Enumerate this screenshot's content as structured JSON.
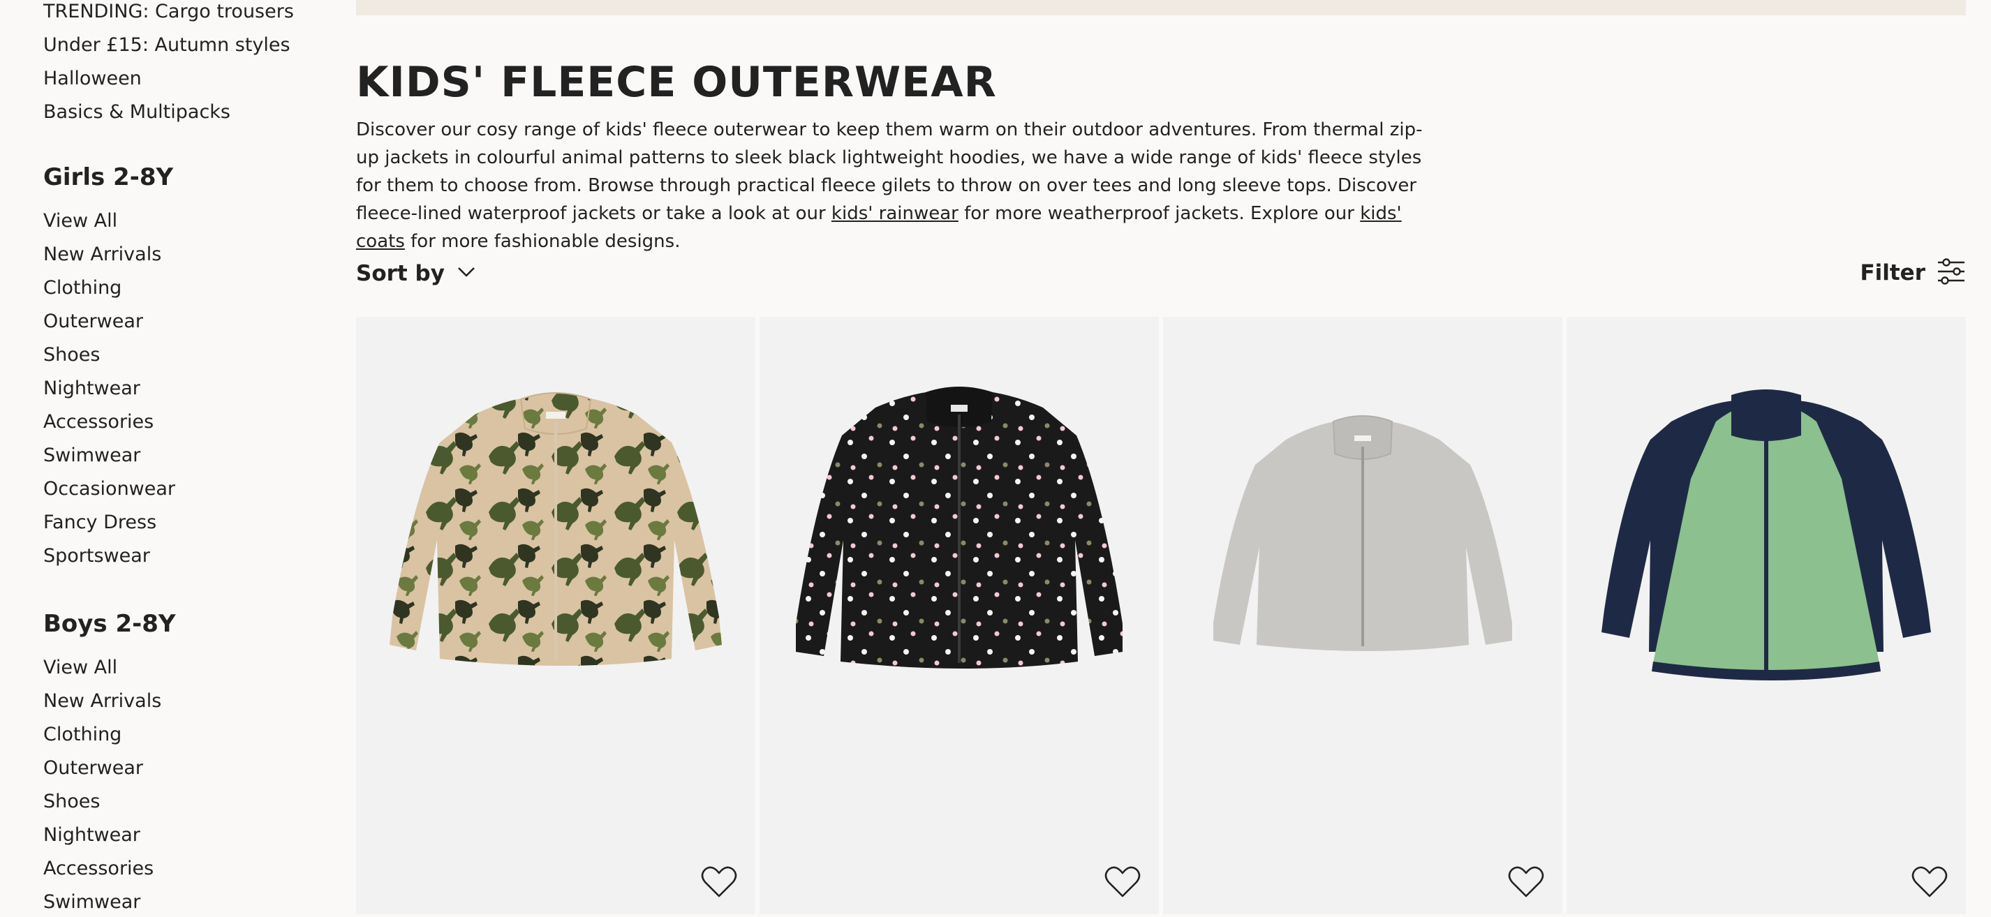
{
  "sidebar": {
    "top_links": [
      {
        "label": "TRENDING: Cargo trousers"
      },
      {
        "label": "Under £15: Autumn styles"
      },
      {
        "label": "Halloween"
      },
      {
        "label": "Basics & Multipacks"
      }
    ],
    "girls": {
      "heading": "Girls 2-8Y",
      "items": [
        {
          "label": "View All"
        },
        {
          "label": "New Arrivals"
        },
        {
          "label": "Clothing"
        },
        {
          "label": "Outerwear"
        },
        {
          "label": "Shoes"
        },
        {
          "label": "Nightwear"
        },
        {
          "label": "Accessories"
        },
        {
          "label": "Swimwear"
        },
        {
          "label": "Occasionwear"
        },
        {
          "label": "Fancy Dress"
        },
        {
          "label": "Sportswear"
        }
      ]
    },
    "boys": {
      "heading": "Boys 2-8Y",
      "items": [
        {
          "label": "View All"
        },
        {
          "label": "New Arrivals"
        },
        {
          "label": "Clothing"
        },
        {
          "label": "Outerwear"
        },
        {
          "label": "Shoes"
        },
        {
          "label": "Nightwear"
        },
        {
          "label": "Accessories"
        },
        {
          "label": "Swimwear"
        }
      ]
    }
  },
  "main": {
    "title": "KIDS' FLEECE OUTERWEAR",
    "description": {
      "part1": "Discover our cosy range of kids' fleece outerwear to keep them warm on their outdoor adventures. From thermal zip-up jackets in colourful animal patterns to sleek black lightweight hoodies, we have a wide range of kids' fleece styles for them to choose from. Browse through practical fleece gilets to throw on over tees and long sleeve tops. Discover fleece-lined waterproof jackets or take a look at our ",
      "link1": "kids' rainwear",
      "part2": " for more weatherproof jackets. Explore our ",
      "link2": "kids' coats",
      "part3": " for more fashionable designs."
    },
    "sort_label": "Sort by",
    "filter_label": "Filter"
  },
  "products": [
    {
      "icon": "dinosaur-print-fleece-jacket",
      "base_color": "#d9c3a3",
      "accent_color": "#4a5a2e"
    },
    {
      "icon": "polka-dot-black-fleece-jacket",
      "base_color": "#1a1a1a",
      "accent_color": "#f2d6de"
    },
    {
      "icon": "grey-fleece-jacket",
      "base_color": "#c9c7c3",
      "accent_color": "#a9a7a3"
    },
    {
      "icon": "navy-green-colourblock-fleece-jacket",
      "base_color": "#8cc08e",
      "accent_color": "#1e2a45"
    }
  ],
  "colors": {
    "background": "#faf9f8",
    "banner": "#f0ebe2",
    "card_background": "#f2f2f2",
    "text": "#222222"
  }
}
